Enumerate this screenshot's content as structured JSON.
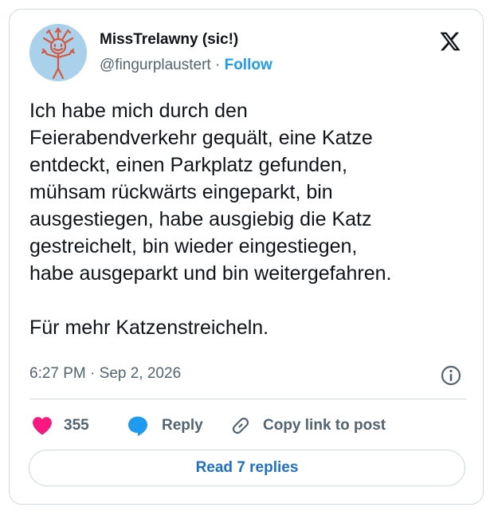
{
  "author": {
    "display_name": "MissTrelawny (sic!)",
    "handle": "@fingurplaustert",
    "separator": "·",
    "follow_label": "Follow",
    "avatar_icon": "smiling-sun-figure-drawing-icon",
    "avatar_bg": "#a9d1ec"
  },
  "brand_icon": "x-logo-icon",
  "tweet": {
    "lines": [
      "Ich habe mich durch den",
      "Feierabendverkehr gequält, eine Katze",
      "entdeckt, einen Parkplatz gefunden,",
      "mühsam rückwärts eingeparkt, bin",
      "ausgestiegen, habe ausgiebig die Katz",
      "gestreichelt, bin wieder eingestiegen,",
      "habe ausgeparkt und bin weitergefahren."
    ],
    "closing_line": "Für mehr Katzenstreicheln."
  },
  "meta": {
    "time": "6:27 PM",
    "separator": "·",
    "date": "Sep 2, 2026",
    "info_icon": "info-icon"
  },
  "actions": {
    "like_count": "355",
    "reply_label": "Reply",
    "copy_label": "Copy link to post"
  },
  "read_replies_label": "Read 7 replies",
  "colors": {
    "accent": "#1d9bf0",
    "like": "#f91880",
    "muted_text": "#536471",
    "border": "#cfd9de"
  }
}
